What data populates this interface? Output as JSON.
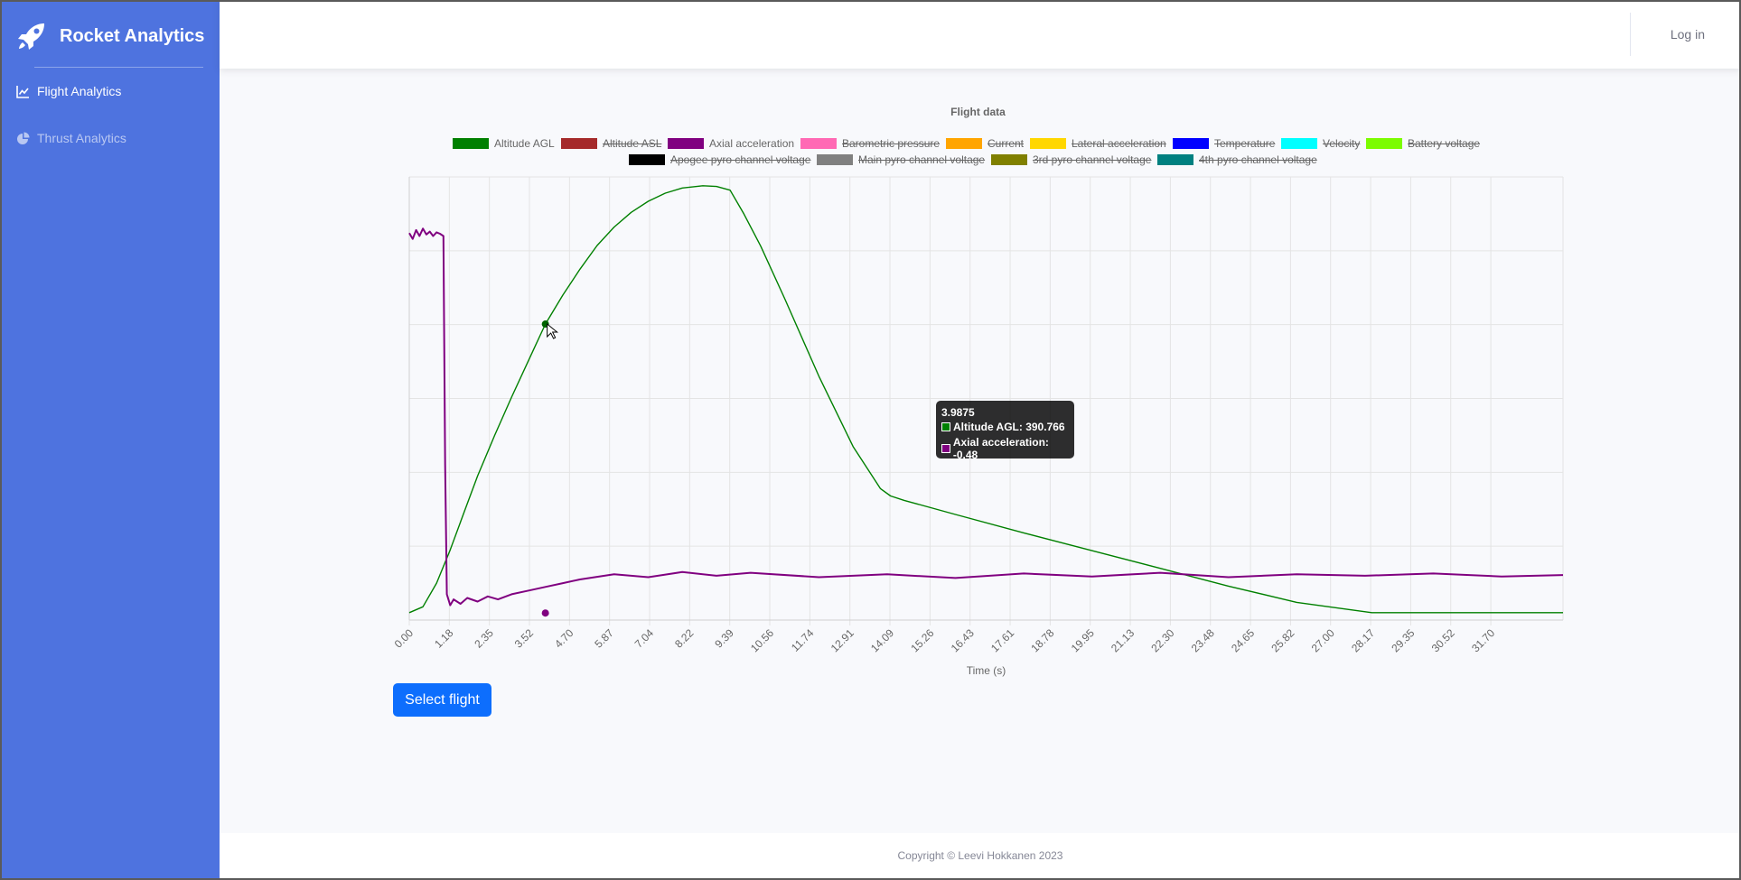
{
  "app": {
    "brand": "Rocket Analytics",
    "login_label": "Log in"
  },
  "sidebar": {
    "items": [
      {
        "label": "Flight Analytics",
        "icon": "chart-line-icon",
        "active": true
      },
      {
        "label": "Thrust Analytics",
        "icon": "chart-pie-icon",
        "active": false
      }
    ]
  },
  "legend_rows": [
    [
      {
        "label": "Altitude AGL",
        "color": "#008000",
        "hidden": false
      },
      {
        "label": "Altitude ASL",
        "color": "#a52a2a",
        "hidden": true
      },
      {
        "label": "Axial acceleration",
        "color": "#800080",
        "hidden": false
      },
      {
        "label": "Barometric pressure",
        "color": "#ff69b4",
        "hidden": true
      },
      {
        "label": "Current",
        "color": "#ffa500",
        "hidden": true
      },
      {
        "label": "Lateral acceleration",
        "color": "#ffd700",
        "hidden": true
      },
      {
        "label": "Temperature",
        "color": "#0000ff",
        "hidden": true
      },
      {
        "label": "Velocity",
        "color": "#00ffff",
        "hidden": true
      },
      {
        "label": "Battery voltage",
        "color": "#7cfc00",
        "hidden": true
      }
    ],
    [
      {
        "label": "Apogee pyro channel voltage",
        "color": "#000000",
        "hidden": true
      },
      {
        "label": "Main pyro channel voltage",
        "color": "#808080",
        "hidden": true
      },
      {
        "label": "3rd pyro channel voltage",
        "color": "#808000",
        "hidden": true
      },
      {
        "label": "4th pyro channel voltage",
        "color": "#008080",
        "hidden": true
      }
    ]
  ],
  "chart_data": {
    "type": "line",
    "title": "Flight data",
    "xlabel": "Time (s)",
    "ylabel": "",
    "x_ticks": [
      "0.00",
      "1.18",
      "2.35",
      "3.52",
      "4.70",
      "5.87",
      "7.04",
      "8.22",
      "9.39",
      "10.56",
      "11.74",
      "12.91",
      "14.09",
      "15.26",
      "16.43",
      "17.61",
      "18.78",
      "19.95",
      "21.13",
      "22.30",
      "23.48",
      "24.65",
      "25.82",
      "27.00",
      "28.17",
      "29.35",
      "30.52",
      "31.70"
    ],
    "x_range": [
      0,
      33.8
    ],
    "y_range": [
      -10,
      590
    ],
    "grid": true,
    "series": [
      {
        "name": "Altitude AGL",
        "color": "#008000",
        "x": [
          0,
          0.4,
          0.8,
          1.2,
          1.6,
          2.0,
          2.5,
          3.0,
          3.5,
          3.9875,
          4.5,
          5.0,
          5.5,
          6.0,
          6.5,
          7.0,
          7.5,
          8.0,
          8.6,
          9.0,
          9.4,
          9.8,
          10.3,
          11.0,
          12.0,
          13.0,
          13.8,
          14.1,
          14.5,
          16.0,
          18.0,
          20.0,
          22.0,
          24.0,
          26.0,
          28.2,
          29.5,
          31.0,
          33.8
        ],
        "y": [
          0,
          8,
          40,
          85,
          135,
          185,
          240,
          292,
          342,
          390.766,
          430,
          465,
          497,
          522,
          542,
          557,
          568,
          575,
          578,
          577,
          572,
          540,
          496,
          425,
          320,
          225,
          168,
          158,
          152,
          133,
          108,
          84,
          60,
          36,
          14,
          0,
          0,
          0,
          0
        ]
      },
      {
        "name": "Axial acceleration",
        "color": "#800080",
        "x": [
          0,
          0.1,
          0.2,
          0.3,
          0.4,
          0.5,
          0.6,
          0.7,
          0.8,
          0.9,
          1.0,
          1.05,
          1.1,
          1.2,
          1.3,
          1.5,
          1.7,
          2.0,
          2.3,
          2.6,
          3.0,
          3.5,
          4.0,
          4.5,
          5.0,
          6.0,
          7.0,
          8.0,
          9.0,
          10.0,
          12.0,
          14.0,
          16.0,
          18.0,
          20.0,
          22.0,
          24.0,
          26.0,
          28.0,
          30.0,
          32.0,
          33.8
        ],
        "y": [
          514,
          506,
          518,
          510,
          520,
          512,
          516,
          510,
          515,
          513,
          510,
          200,
          25,
          10,
          18,
          12,
          20,
          15,
          22,
          18,
          25,
          30,
          35,
          40,
          45,
          52,
          48,
          55,
          50,
          54,
          48,
          52,
          47,
          53,
          49,
          54,
          48,
          52,
          50,
          53,
          49,
          51
        ]
      }
    ],
    "tooltip": {
      "title": "3.9875",
      "items": [
        {
          "label": "Altitude AGL: 390.766",
          "color": "#008000"
        },
        {
          "label": "Axial acceleration: -0.48",
          "color": "#800080"
        }
      ]
    }
  },
  "actions": {
    "select_flight_label": "Select flight"
  },
  "footer": {
    "copyright": "Copyright © Leevi Hokkanen 2023"
  }
}
